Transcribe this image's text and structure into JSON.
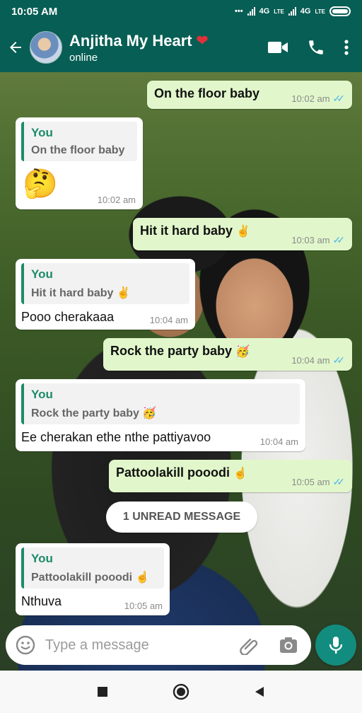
{
  "status_bar": {
    "time": "10:05 AM",
    "network_1": "4G",
    "network_2": "4G",
    "lte": "LTE"
  },
  "header": {
    "contact_name": "Anjitha My Heart",
    "heart": "❤",
    "status": "online"
  },
  "messages": [
    {
      "type": "outgoing",
      "text": "On the floor baby",
      "time": "10:02 am"
    },
    {
      "type": "incoming",
      "quote_author": "You",
      "quote_text": "On the floor baby",
      "text": "🤔",
      "time": "10:02 am"
    },
    {
      "type": "outgoing",
      "text": "Hit it hard baby",
      "emoji": "✌",
      "time": "10:03 am"
    },
    {
      "type": "incoming",
      "quote_author": "You",
      "quote_text": "Hit it hard baby",
      "quote_emoji": "✌",
      "text": "Pooo cherakaaa",
      "time": "10:04 am"
    },
    {
      "type": "outgoing",
      "text": "Rock the party baby",
      "emoji": "🥳",
      "time": "10:04 am"
    },
    {
      "type": "incoming",
      "quote_author": "You",
      "quote_text": "Rock the party baby",
      "quote_emoji": "🥳",
      "text": "Ee cherakan ethe nthe pattiyavoo",
      "time": "10:04 am"
    },
    {
      "type": "outgoing",
      "text": "Pattoolakill pooodi",
      "emoji": "☝",
      "time": "10:05 am"
    },
    {
      "type": "incoming",
      "quote_author": "You",
      "quote_text": "Pattoolakill pooodi",
      "quote_emoji": "☝",
      "text": "Nthuva",
      "time": "10:05 am"
    }
  ],
  "unread_banner": "1 UNREAD MESSAGE",
  "input": {
    "placeholder": "Type a message"
  },
  "colors": {
    "header": "#075e54",
    "outgoing_bubble": "#e1f7cb",
    "incoming_bubble": "#ffffff",
    "accent": "#128c7e",
    "read_ticks": "#4fb6ec"
  },
  "icons": [
    "back-arrow-icon",
    "video-call-icon",
    "phone-icon",
    "more-vert-icon",
    "emoji-icon",
    "attach-icon",
    "camera-icon",
    "mic-icon",
    "nav-recent-icon",
    "nav-home-icon",
    "nav-back-icon"
  ]
}
